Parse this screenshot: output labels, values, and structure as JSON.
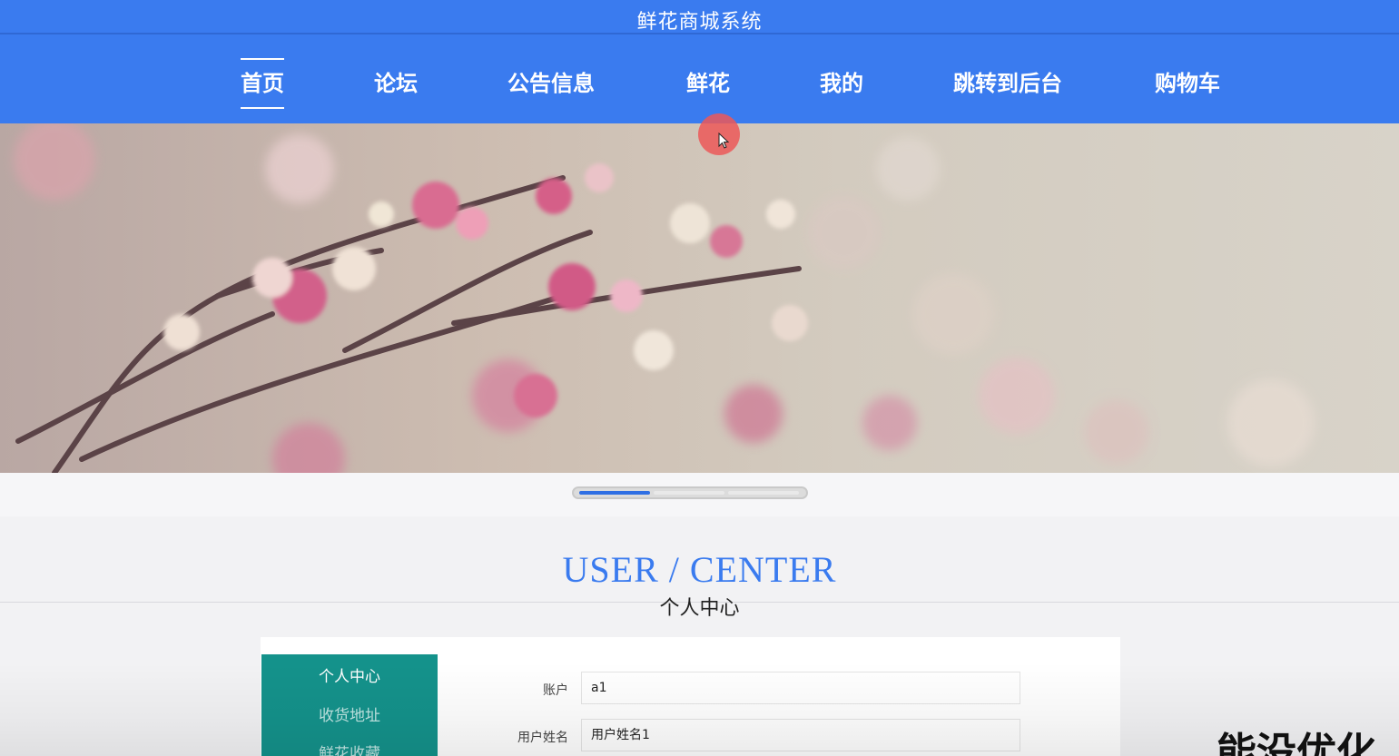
{
  "header": {
    "site_title": "鲜花商城系统"
  },
  "nav": {
    "items": [
      {
        "label": "首页",
        "active": true
      },
      {
        "label": "论坛",
        "active": false
      },
      {
        "label": "公告信息",
        "active": false
      },
      {
        "label": "鲜花",
        "active": false
      },
      {
        "label": "我的",
        "active": false
      },
      {
        "label": "跳转到后台",
        "active": false
      },
      {
        "label": "购物车",
        "active": false
      }
    ]
  },
  "carousel": {
    "slide_count": 3,
    "active_slide": 1
  },
  "section": {
    "title_en": "USER / CENTER",
    "title_zh": "个人中心"
  },
  "sidebar": {
    "items": [
      {
        "label": "个人中心"
      },
      {
        "label": "收货地址"
      },
      {
        "label": "鲜花收藏"
      }
    ]
  },
  "form": {
    "account_label": "账户",
    "account_value": "a1",
    "name_label": "用户姓名",
    "name_value": "用户姓名1"
  },
  "overlay": {
    "text": "能没优化"
  },
  "colors": {
    "primary": "#3a7bef",
    "sidebar": "#14928b",
    "slider_active": "#2f6fe4"
  }
}
